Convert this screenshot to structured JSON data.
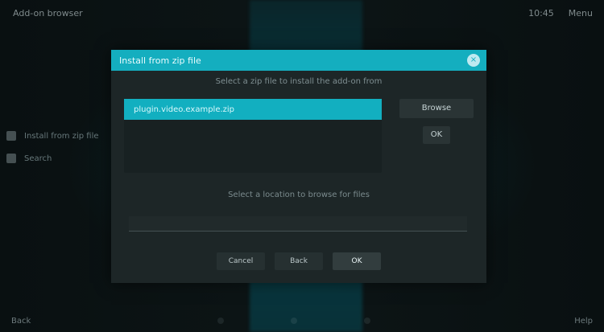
{
  "window": {
    "title": "Add-on browser",
    "top_right": [
      "10:45",
      "Menu"
    ]
  },
  "sidebar": {
    "items": [
      {
        "label": "Install from zip file",
        "icon": "zip-icon"
      },
      {
        "label": "Search",
        "icon": "search-icon"
      }
    ]
  },
  "dialog": {
    "title": "Install from zip file",
    "subtitle": "Select a zip file to install the add-on from",
    "list": {
      "selected_item": "plugin.video.example.zip",
      "items": [
        "",
        ""
      ]
    },
    "side_buttons": [
      {
        "label": "Browse"
      },
      {
        "label": "OK"
      }
    ],
    "small_labels": [
      "",
      ""
    ],
    "info_text": "Select a location to browse for files",
    "input_placeholder": "",
    "actions": [
      {
        "label": "Cancel"
      },
      {
        "label": "Back"
      },
      {
        "label": "OK"
      }
    ]
  },
  "footer": {
    "left": "Back",
    "right": "Help"
  }
}
